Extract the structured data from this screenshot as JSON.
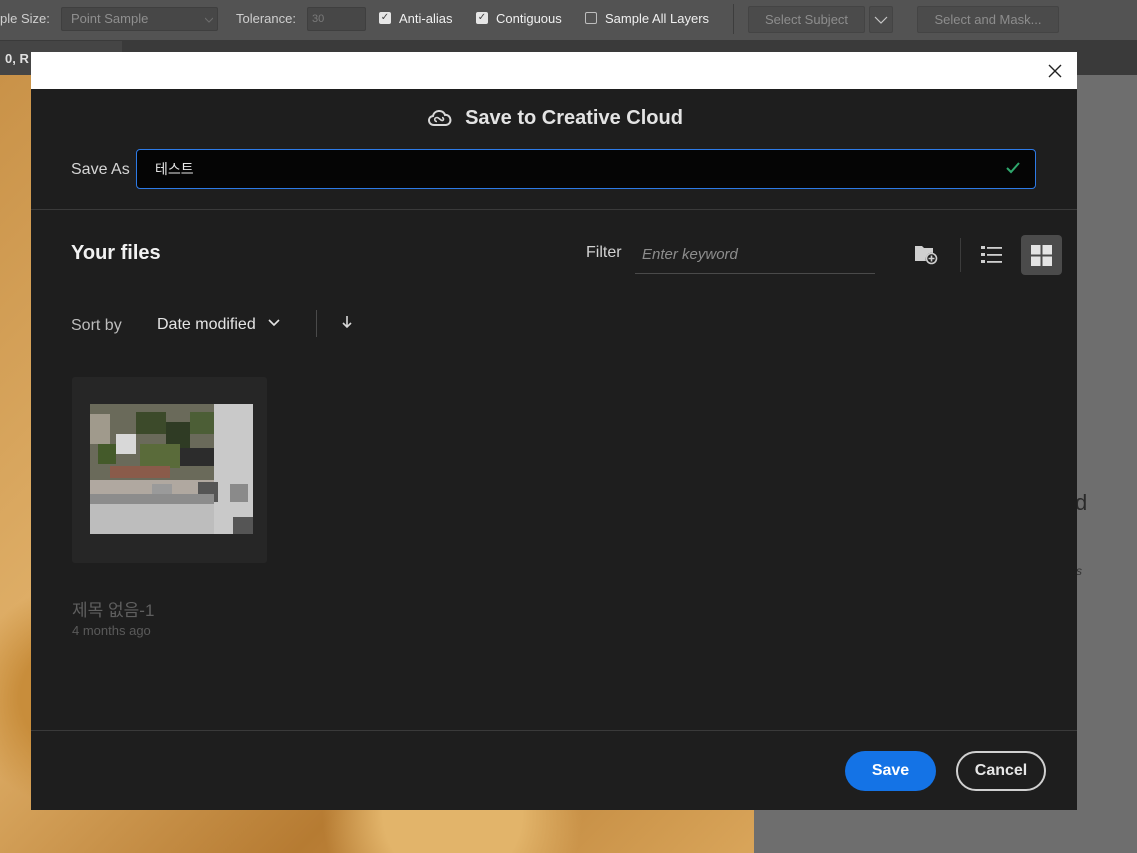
{
  "options_bar": {
    "sample_size_label": "ple Size:",
    "sample_size_value": "Point Sample",
    "tolerance_label": "Tolerance:",
    "tolerance_value": "30",
    "anti_alias_label": "Anti-alias",
    "anti_alias_checked": true,
    "contiguous_label": "Contiguous",
    "contiguous_checked": true,
    "sample_all_layers_label": "Sample All Layers",
    "sample_all_layers_checked": false,
    "select_subject_label": "Select Subject",
    "select_and_mask_label": "Select and Mask..."
  },
  "doc_tab": {
    "label": "0, R"
  },
  "background_fragments": {
    "big_letter": "d",
    "small_letter": "s"
  },
  "dialog": {
    "title": "Save to Creative Cloud",
    "save_as_label": "Save As",
    "save_as_value": "테스트",
    "files_heading": "Your files",
    "filter_label": "Filter",
    "filter_placeholder": "Enter keyword",
    "sort_by_label": "Sort by",
    "sort_by_value": "Date modified",
    "files": [
      {
        "name": "제목 없음-1",
        "modified": "4 months ago"
      }
    ],
    "save_button": "Save",
    "cancel_button": "Cancel",
    "accent_color": "#1473e6",
    "valid_color": "#2fa86d"
  }
}
